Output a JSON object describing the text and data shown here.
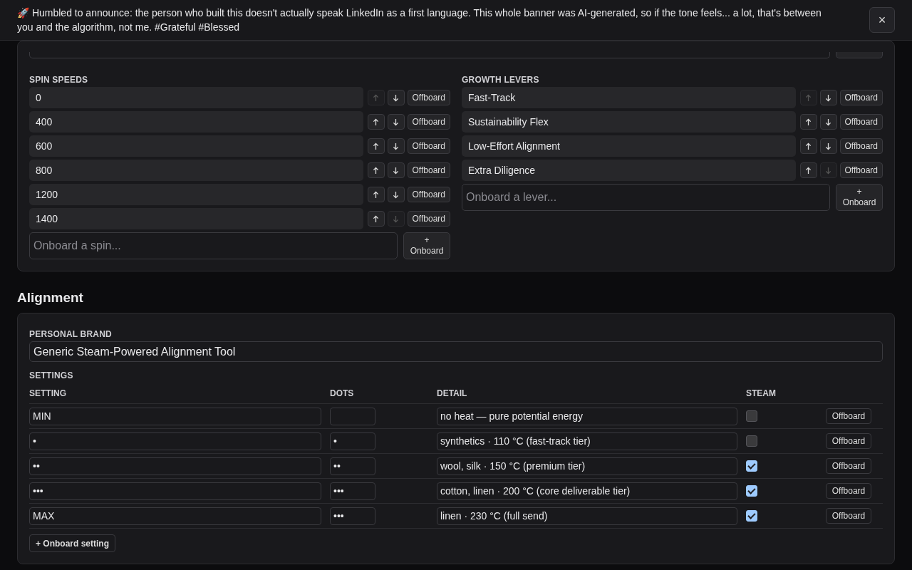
{
  "banner": {
    "text": "🚀 Humbled to announce: the person who built this doesn't actually speak LinkedIn as a first language. This whole banner was AI-generated, so if the tone feels... a lot, that's between you and the algorithm, not me. #Grateful #Blessed",
    "close": "×"
  },
  "top_panel": {
    "lists": [
      {
        "label": "SPIN SPEEDS",
        "items": [
          {
            "value": "0",
            "can_move_up": false,
            "can_move_down": true,
            "offboard": "Offboard"
          },
          {
            "value": "400",
            "can_move_up": true,
            "can_move_down": true,
            "offboard": "Offboard"
          },
          {
            "value": "600",
            "can_move_up": true,
            "can_move_down": true,
            "offboard": "Offboard"
          },
          {
            "value": "800",
            "can_move_up": true,
            "can_move_down": true,
            "offboard": "Offboard"
          },
          {
            "value": "1200",
            "can_move_up": true,
            "can_move_down": true,
            "offboard": "Offboard"
          },
          {
            "value": "1400",
            "can_move_up": true,
            "can_move_down": false,
            "offboard": "Offboard"
          }
        ],
        "add_placeholder": "Onboard a spin...",
        "add_button": [
          "+",
          "Onboard"
        ]
      },
      {
        "label": "GROWTH LEVERS",
        "items": [
          {
            "value": "Fast-Track",
            "can_move_up": false,
            "can_move_down": true,
            "offboard": "Offboard"
          },
          {
            "value": "Sustainability Flex",
            "can_move_up": true,
            "can_move_down": true,
            "offboard": "Offboard"
          },
          {
            "value": "Low-Effort Alignment",
            "can_move_up": true,
            "can_move_down": true,
            "offboard": "Offboard"
          },
          {
            "value": "Extra Diligence",
            "can_move_up": true,
            "can_move_down": false,
            "offboard": "Offboard"
          }
        ],
        "add_placeholder": "Onboard a lever...",
        "add_button": [
          "+",
          "Onboard"
        ]
      }
    ]
  },
  "alignment": {
    "title": "Alignment",
    "brand_label": "PERSONAL BRAND",
    "brand_value": "Generic Steam-Powered Alignment Tool",
    "settings_label": "SETTINGS",
    "columns": [
      "SETTING",
      "DOTS",
      "DETAIL",
      "STEAM"
    ],
    "rows": [
      {
        "setting": "MIN",
        "dots": "",
        "detail": "no heat — pure potential energy",
        "steam": false,
        "action": "Offboard"
      },
      {
        "setting": "•",
        "dots": "•",
        "detail": "synthetics · 110 °C (fast-track tier)",
        "steam": false,
        "action": "Offboard"
      },
      {
        "setting": "••",
        "dots": "••",
        "detail": "wool, silk · 150 °C (premium tier)",
        "steam": true,
        "action": "Offboard"
      },
      {
        "setting": "•••",
        "dots": "•••",
        "detail": "cotton, linen · 200 °C (core deliverable tier)",
        "steam": true,
        "action": "Offboard"
      },
      {
        "setting": "MAX",
        "dots": "•••",
        "detail": "linen · 230 °C (full send)",
        "steam": true,
        "action": "Offboard"
      }
    ],
    "add_button": "+ Onboard setting"
  }
}
